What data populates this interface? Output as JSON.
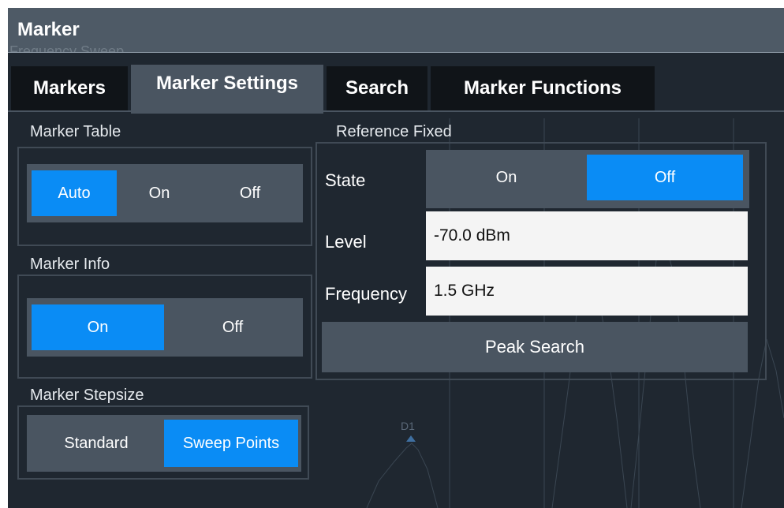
{
  "window": {
    "title": "Marker",
    "ghost_text": "Frequency Sweep"
  },
  "tabs": [
    {
      "label": "Markers"
    },
    {
      "label": "Marker Settings",
      "active": true
    },
    {
      "label": "Search"
    },
    {
      "label": "Marker Functions"
    }
  ],
  "marker_table": {
    "label": "Marker Table",
    "options": [
      "Auto",
      "On",
      "Off"
    ],
    "selected": "Auto"
  },
  "marker_info": {
    "label": "Marker Info",
    "options": [
      "On",
      "Off"
    ],
    "selected": "On"
  },
  "marker_stepsize": {
    "label": "Marker Stepsize",
    "options": [
      "Standard",
      "Sweep Points"
    ],
    "selected": "Sweep Points"
  },
  "reference_fixed": {
    "label": "Reference Fixed",
    "state_label": "State",
    "state_options": [
      "On",
      "Off"
    ],
    "state_selected": "Off",
    "level_label": "Level",
    "level_value": "-70.0 dBm",
    "frequency_label": "Frequency",
    "frequency_value": "1.5 GHz",
    "peak_search_label": "Peak Search"
  },
  "background_marker": "D1",
  "colors": {
    "accent": "#0a8cf5",
    "panel": "#4a5561",
    "background": "#1f2730",
    "titlebar": "#4e5a66"
  }
}
